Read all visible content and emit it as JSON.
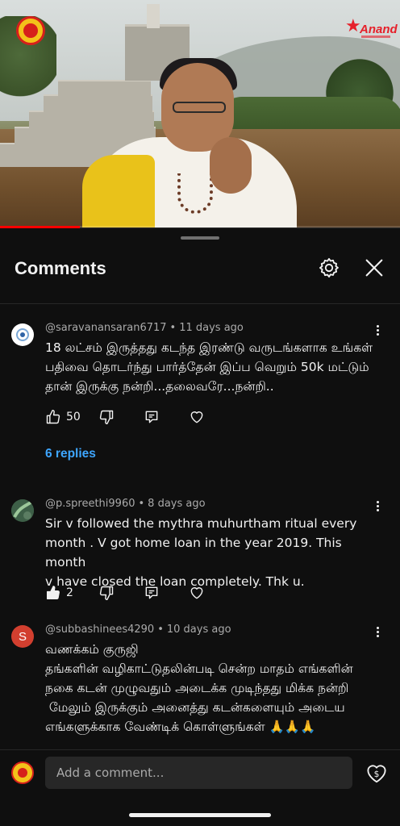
{
  "video": {
    "progress_fraction": 0.2
  },
  "header": {
    "title": "Comments"
  },
  "comments": [
    {
      "author": "@saravanansaran6717",
      "time": "11 days ago",
      "lines": [
        "18 லட்சம் இருத்தது கடந்த இரண்டு வருடங்களாக உங்கள்",
        "பதிவை தொடர்ந்து பார்த்தேன் இப்ப வெறும் 50k மட்டும்",
        "தான் இருக்கு நன்றி...தலைவரே...நன்றி.."
      ],
      "likes": "50",
      "liked": false,
      "replies": "6 replies"
    },
    {
      "author": "@p.spreethi9960",
      "time": "8 days ago",
      "lines": [
        "Sir v followed the mythra muhurtham ritual every",
        "month . V got home loan in the year 2019. This month",
        "v have closed the loan completely. Thk u."
      ],
      "likes": "2",
      "liked": true
    },
    {
      "author": "@subbashinees4290",
      "time": "10 days ago",
      "avatar_letter": "S",
      "avatar_color": "#d23f2f",
      "lines": [
        "வணக்கம் குருஜி",
        "தங்களின் வழிகாட்டுதலின்படி சென்ற மாதம் எங்களின்",
        "நகை கடன் முழுவதும் அடைக்க முடிந்தது மிக்க நன்றி",
        " மேலும் இருக்கும் அனைத்து கடன்களையும் அடைய",
        "எங்களுக்காக வேண்டிக் கொள்ளுங்கள் 🙏🙏🙏"
      ]
    }
  ],
  "composer": {
    "placeholder": "Add a comment..."
  },
  "colors": {
    "link": "#3ea6ff",
    "background": "#0f0f0f",
    "progress": "#ff0000"
  }
}
